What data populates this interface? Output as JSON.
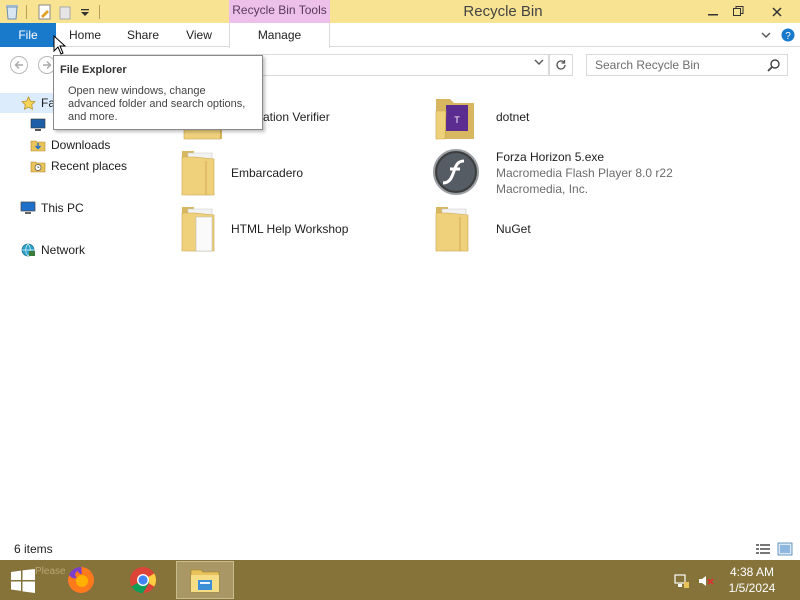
{
  "window": {
    "title": "Recycle Bin",
    "context_tab_group": "Recycle Bin Tools"
  },
  "ribbon": {
    "tabs": [
      "File",
      "Home",
      "Share",
      "View",
      "Manage"
    ]
  },
  "search": {
    "placeholder": "Search Recycle Bin"
  },
  "tooltip": {
    "title": "File Explorer",
    "body": "Open new windows, change advanced folder and search options, and more."
  },
  "nav": {
    "favorites_partial": "Fa",
    "downloads": "Downloads",
    "recent_places": "Recent places",
    "this_pc": "This PC",
    "network": "Network"
  },
  "items": [
    {
      "name": "cation Verifier",
      "icon": "folder-icon"
    },
    {
      "name": "dotnet",
      "icon": "folder-icon"
    },
    {
      "name": "Embarcadero",
      "icon": "folder-icon"
    },
    {
      "name": "Forza Horizon 5.exe",
      "sub1": "Macromedia Flash Player 8.0  r22",
      "sub2": "Macromedia, Inc.",
      "icon": "flash-player-icon"
    },
    {
      "name": "HTML Help Workshop",
      "icon": "folder-icon"
    },
    {
      "name": "NuGet",
      "icon": "folder-icon"
    }
  ],
  "status": {
    "item_count": "6 items"
  },
  "taskbar": {
    "ghost_text": "Please",
    "time": "4:38 AM",
    "date": "1/5/2024"
  },
  "colors": {
    "titlebar": "#f7e391",
    "context_tab": "#ecc0e8",
    "file_tab": "#1979ca",
    "taskbar": "#85733a"
  }
}
